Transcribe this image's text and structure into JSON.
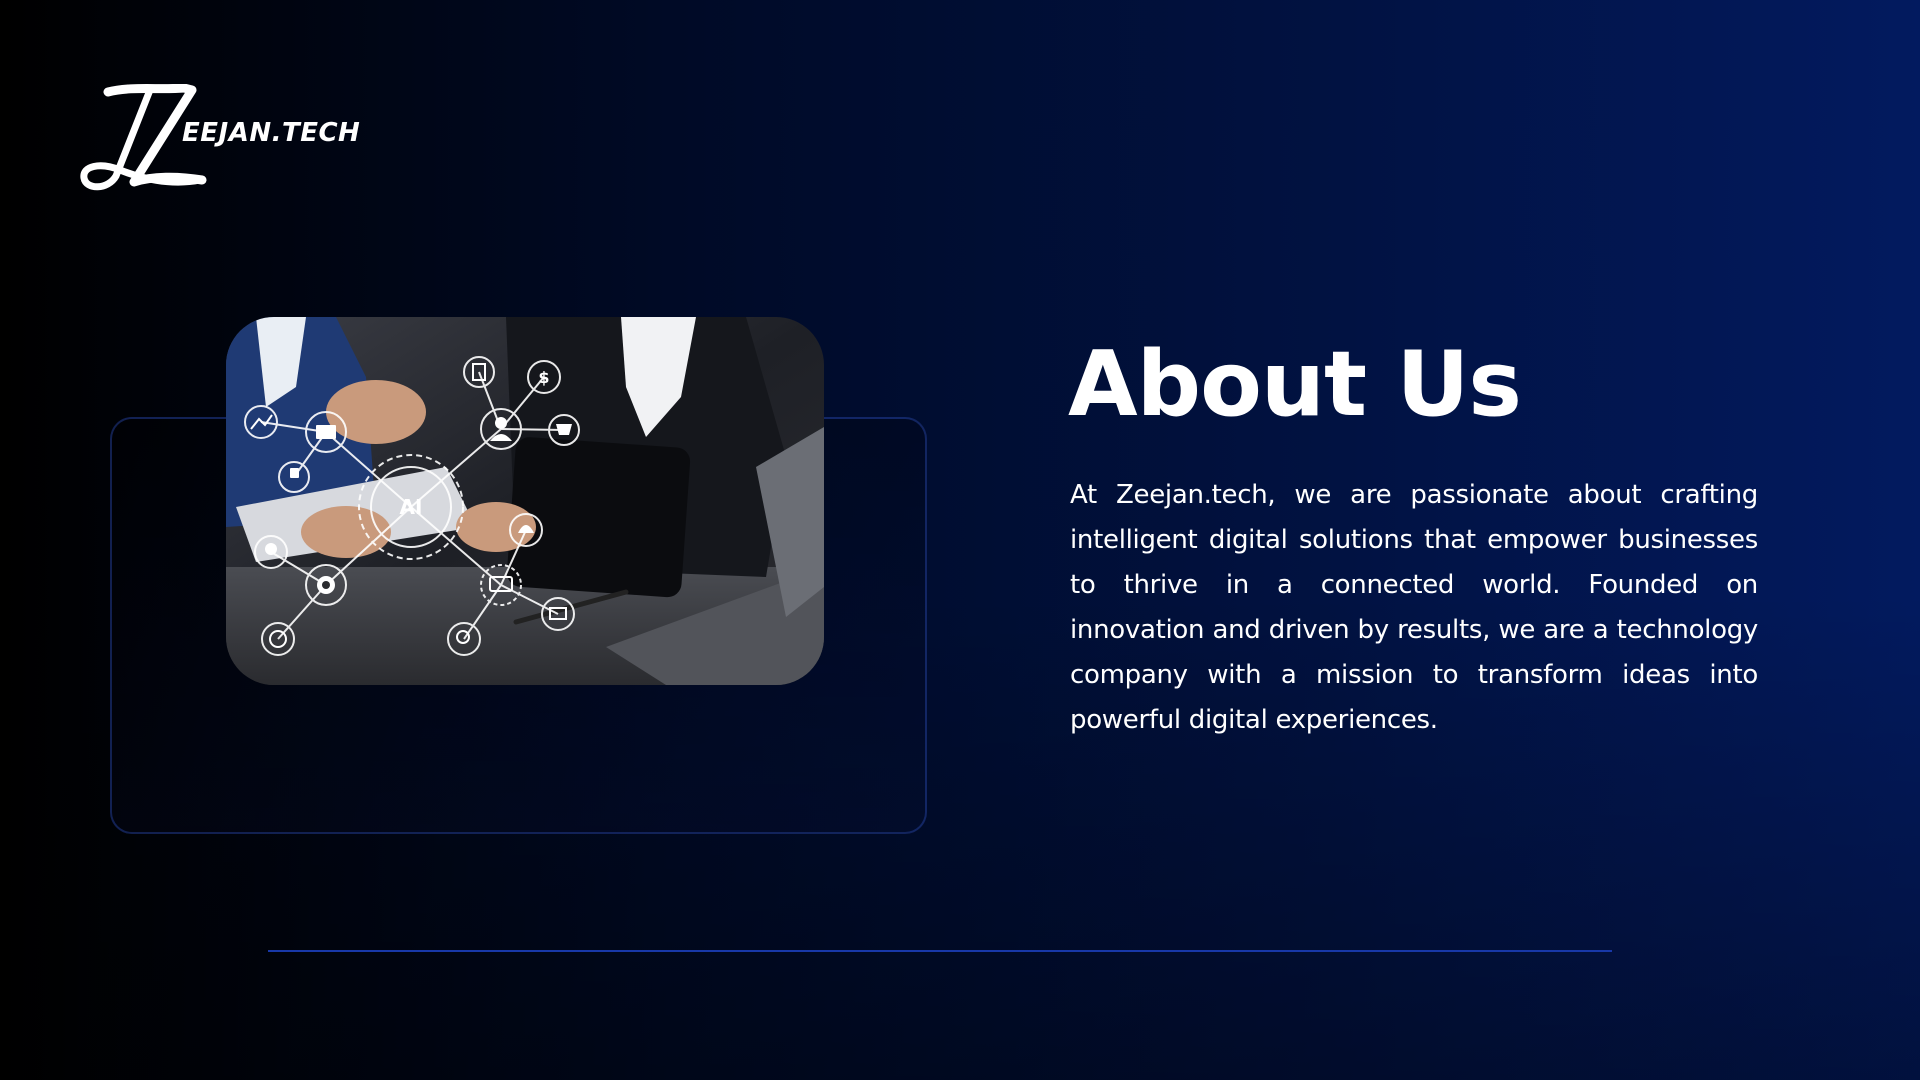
{
  "brand": {
    "logo_letters": "ZL",
    "name": "EEJAN.TECH"
  },
  "about": {
    "title": "About Us",
    "description": "At Zeejan.tech, we are passionate about crafting intelligent digital solutions that empower businesses to thrive in a connected world. Founded on innovation and driven by results, we are a technology company with a mission to transform ideas into powerful digital experiences."
  },
  "photo": {
    "center_label": "AI"
  },
  "colors": {
    "background_dark": "#000000",
    "background_blue": "#021a5f",
    "divider": "#1838a8",
    "text": "#ffffff"
  }
}
